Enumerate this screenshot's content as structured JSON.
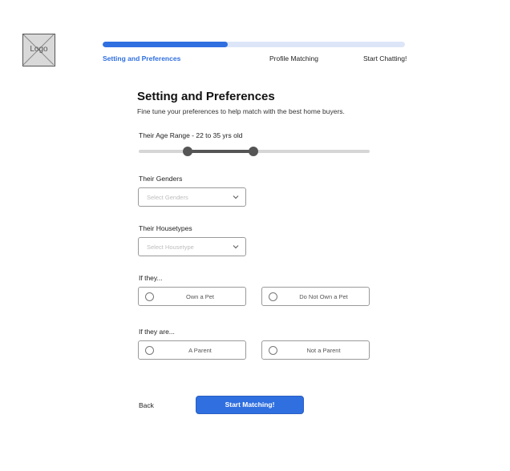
{
  "logo": {
    "text": "Logo"
  },
  "progress": {
    "fraction": 0.415,
    "steps": [
      {
        "label": "Setting and Preferences",
        "active": true
      },
      {
        "label": "Profile Matching",
        "active": false
      },
      {
        "label": "Start Chatting!",
        "active": false
      }
    ]
  },
  "header": {
    "title": "Setting and Preferences",
    "subtitle": "Fine tune your preferences to help match with the best home buyers."
  },
  "age_range": {
    "label": "Their Age Range - 22 to 35 yrs old",
    "min": 22,
    "max": 35
  },
  "genders": {
    "label": "Their Genders",
    "placeholder": "Select Genders",
    "icon": "chevron-down-icon"
  },
  "housetypes": {
    "label": "Their Housetypes",
    "placeholder": "Select Housetype",
    "icon": "chevron-down-icon"
  },
  "pet": {
    "label": "If they...",
    "options": [
      "Own a Pet",
      "Do Not Own a Pet"
    ]
  },
  "parent": {
    "label": "If they are...",
    "options": [
      "A Parent",
      "Not a Parent"
    ]
  },
  "footer": {
    "back_label": "Back",
    "start_label": "Start Matching!"
  },
  "colors": {
    "accent": "#2f6fe0",
    "track": "#dde6f8",
    "slider": "#555555"
  }
}
